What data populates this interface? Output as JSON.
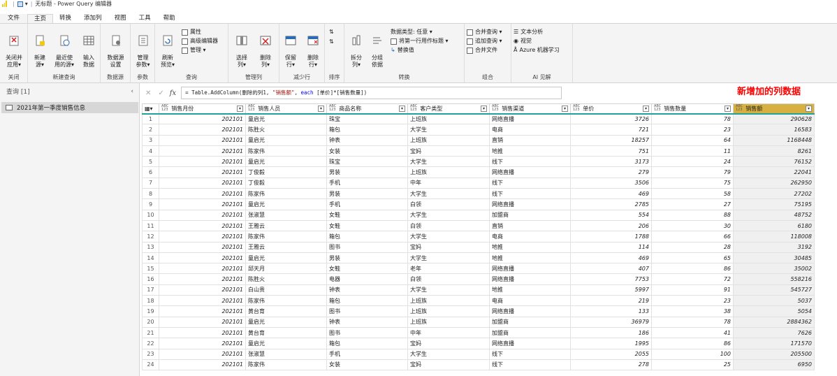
{
  "titlebar": {
    "title": "无标题 - Power Query 编辑器"
  },
  "menu": [
    {
      "label": "文件",
      "active": false
    },
    {
      "label": "主页",
      "active": true
    },
    {
      "label": "转换",
      "active": false
    },
    {
      "label": "添加列",
      "active": false
    },
    {
      "label": "视图",
      "active": false
    },
    {
      "label": "工具",
      "active": false
    },
    {
      "label": "帮助",
      "active": false
    }
  ],
  "ribbon": {
    "close_apply": "关闭并\n应用▾",
    "close_group": "关闭",
    "new_source": "新建\n源▾",
    "recent_sources": "最近使\n用的源▾",
    "enter_data": "输入\n数据",
    "new_query_group": "新建查询",
    "data_source_settings": "数据源\n设置",
    "data_source_group": "数据源",
    "manage_params": "管理\n参数▾",
    "params_group": "参数",
    "refresh_preview": "刷新\n预览▾",
    "properties": "属性",
    "advanced_editor": "高级编辑器",
    "manage": "管理 ▾",
    "query_group": "查询",
    "choose_columns": "选择\n列▾",
    "remove_columns": "删除\n列▾",
    "manage_columns_group": "管理列",
    "keep_rows": "保留\n行▾",
    "remove_rows": "删除\n行▾",
    "reduce_rows_group": "减少行",
    "sort_group": "排序",
    "split_column": "拆分\n列▾",
    "group_by": "分组\n依据",
    "data_type": "数据类型: 任意 ▾",
    "use_first_row": "将第一行用作标题 ▾",
    "replace_values": "替换值",
    "transform_group": "转换",
    "merge_queries": "合并查询 ▾",
    "append_queries": "追加查询 ▾",
    "combine_files": "合并文件",
    "combine_group": "组合",
    "text_analytics": "文本分析",
    "vision": "视觉",
    "azure_ml": "Azure 机器学习",
    "ai_group": "AI 见解"
  },
  "queries": {
    "header": "查询 [1]",
    "items": [
      "2021年第一季度销售信息"
    ]
  },
  "formula": {
    "prefix": "= Table.AddColumn(删除的列1, ",
    "str": "\"销售额\"",
    "mid": ", ",
    "kw": "each",
    "suffix": " [单价]*[销售数量])"
  },
  "annotation": "新增加的列数据",
  "columns": [
    {
      "type_top": "ABC",
      "type_bot": "123",
      "name": "销售月份"
    },
    {
      "type_top": "ABC",
      "type_bot": "123",
      "name": "销售人员"
    },
    {
      "type_top": "ABC",
      "type_bot": "123",
      "name": "商品名称"
    },
    {
      "type_top": "ABC",
      "type_bot": "123",
      "name": "客户类型"
    },
    {
      "type_top": "ABC",
      "type_bot": "123",
      "name": "销售渠道"
    },
    {
      "type_top": "ABC",
      "type_bot": "123",
      "name": "单价"
    },
    {
      "type_top": "ABC",
      "type_bot": "123",
      "name": "销售数量"
    },
    {
      "type_top": "ABC",
      "type_bot": "123",
      "name": "销售额"
    }
  ],
  "rows": [
    [
      "202101 ",
      "童启光",
      "珠宝",
      "上班族",
      "网络直播",
      "3726",
      "78",
      "290628"
    ],
    [
      "202101 ",
      "陈胜火",
      "箱包",
      "大学生",
      "电商",
      "721",
      "23",
      "16583"
    ],
    [
      "202101 ",
      "童启光",
      "钟表",
      "上班族",
      "直销",
      "18257",
      "64",
      "1168448"
    ],
    [
      "202101 ",
      "陈家伟",
      "女装",
      "宝妈",
      "地推",
      "751",
      "11",
      "8261"
    ],
    [
      "202101 ",
      "童启光",
      "珠宝",
      "大学生",
      "线下",
      "3173",
      "24",
      "76152"
    ],
    [
      "202101 ",
      "丁俊毅",
      "男装",
      "上班族",
      "网络直播",
      "279",
      "79",
      "22041"
    ],
    [
      "202101 ",
      "丁俊毅",
      "手机",
      "中年",
      "线下",
      "3506",
      "75",
      "262950"
    ],
    [
      "202101 ",
      "陈家伟",
      "男装",
      "大学生",
      "线下",
      "469",
      "58",
      "27202"
    ],
    [
      "202101 ",
      "童启光",
      "手机",
      "白领",
      "网络直播",
      "2785",
      "27",
      "75195"
    ],
    [
      "202101 ",
      "张淑慧",
      "女鞋",
      "大学生",
      "加盟商",
      "554",
      "88",
      "48752"
    ],
    [
      "202101 ",
      "王雅云",
      "女鞋",
      "白领",
      "直销",
      "206",
      "30",
      "6180"
    ],
    [
      "202101 ",
      "陈家伟",
      "箱包",
      "大学生",
      "电商",
      "1788",
      "66",
      "118008"
    ],
    [
      "202101 ",
      "王雅云",
      "图书",
      "宝妈",
      "地推",
      "114",
      "28",
      "3192"
    ],
    [
      "202101 ",
      "童启光",
      "男装",
      "大学生",
      "地推",
      "469",
      "65",
      "30485"
    ],
    [
      "202101 ",
      "邱天月",
      "女鞋",
      "老年",
      "网络直播",
      "407",
      "86",
      "35002"
    ],
    [
      "202101 ",
      "陈胜火",
      "电器",
      "白领",
      "网络直播",
      "7753",
      "72",
      "558216"
    ],
    [
      "202101 ",
      "白山贵",
      "钟表",
      "大学生",
      "地推",
      "5997",
      "91",
      "545727"
    ],
    [
      "202101 ",
      "陈家伟",
      "箱包",
      "上班族",
      "电商",
      "219",
      "23",
      "5037"
    ],
    [
      "202101 ",
      "黄台育",
      "图书",
      "上班族",
      "网络直播",
      "133",
      "38",
      "5054"
    ],
    [
      "202101 ",
      "童启光",
      "钟表",
      "上班族",
      "加盟商",
      "36979",
      "78",
      "2884362"
    ],
    [
      "202101 ",
      "黄台育",
      "图书",
      "中年",
      "加盟商",
      "186",
      "41",
      "7626"
    ],
    [
      "202101 ",
      "童启光",
      "箱包",
      "宝妈",
      "网络直播",
      "1995",
      "86",
      "171570"
    ],
    [
      "202101 ",
      "张淑慧",
      "手机",
      "大学生",
      "线下",
      "2055",
      "100",
      "205500"
    ],
    [
      "202101 ",
      "陈家伟",
      "女装",
      "宝妈",
      "线下",
      "278",
      "25",
      "6950"
    ]
  ]
}
